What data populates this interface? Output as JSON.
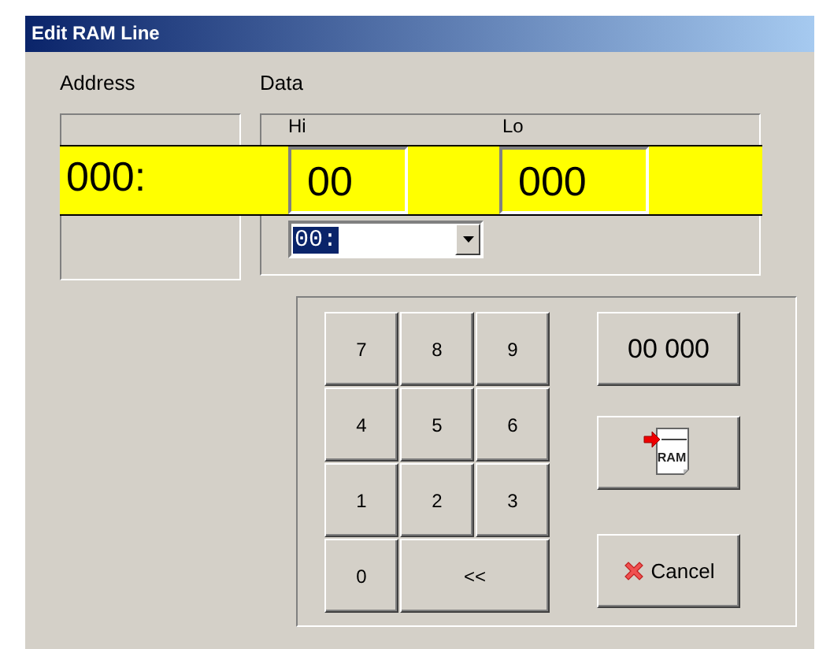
{
  "window": {
    "title": "Edit RAM Line"
  },
  "address": {
    "label": "Address",
    "value": "000:"
  },
  "data": {
    "label": "Data",
    "hi_label": "Hi",
    "hi_value": "00",
    "lo_label": "Lo",
    "lo_value": "000",
    "dropdown": {
      "value": "00:",
      "highlighted": true
    }
  },
  "keypad": [
    {
      "label": "7",
      "kind": "key"
    },
    {
      "label": "8",
      "kind": "key"
    },
    {
      "label": "9",
      "kind": "key"
    },
    {
      "label": "4",
      "kind": "key"
    },
    {
      "label": "5",
      "kind": "key"
    },
    {
      "label": "6",
      "kind": "key"
    },
    {
      "label": "1",
      "kind": "key"
    },
    {
      "label": "2",
      "kind": "key"
    },
    {
      "label": "3",
      "kind": "key"
    },
    {
      "label": "0",
      "kind": "key"
    },
    {
      "label": "<<",
      "kind": "wide"
    }
  ],
  "buttons": [
    {
      "kind": "value",
      "label": "00 000"
    },
    {
      "kind": "write",
      "icon_text": "RAM"
    },
    {
      "kind": "cancel",
      "label": "Cancel"
    }
  ]
}
